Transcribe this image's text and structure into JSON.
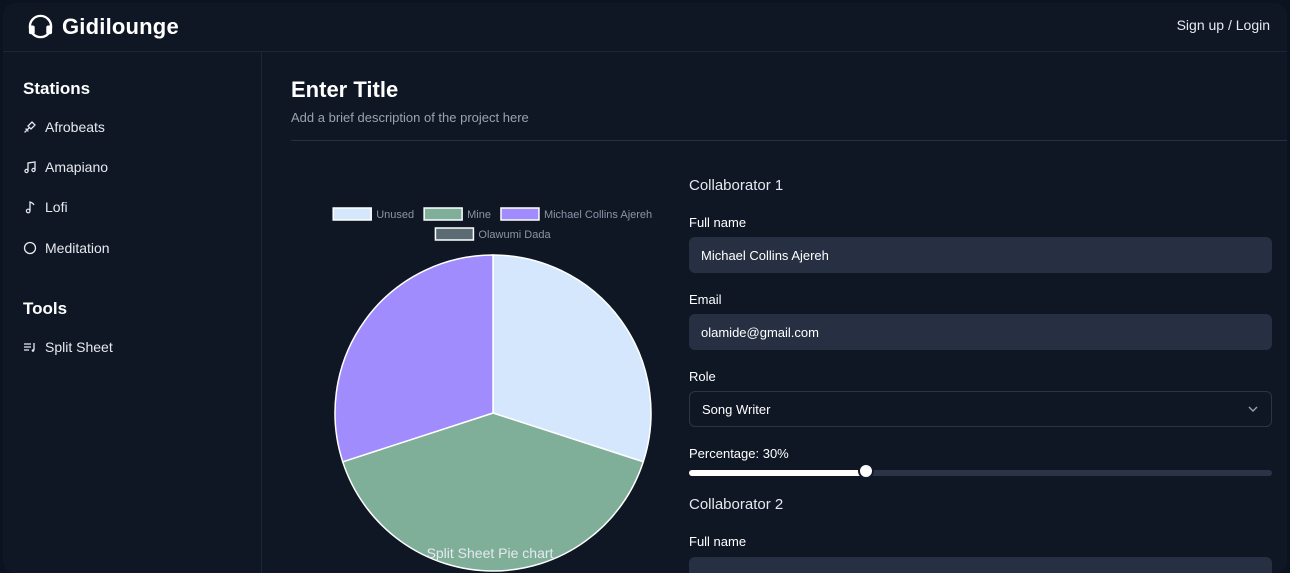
{
  "app": {
    "name": "Gidilounge",
    "auth_link": "Sign up / Login"
  },
  "sidebar": {
    "stations_title": "Stations",
    "stations": [
      {
        "label": "Afrobeats",
        "icon": "guitar-icon"
      },
      {
        "label": "Amapiano",
        "icon": "music-notes-icon"
      },
      {
        "label": "Lofi",
        "icon": "music-note-icon"
      },
      {
        "label": "Meditation",
        "icon": "circle-icon"
      }
    ],
    "tools_title": "Tools",
    "tools": [
      {
        "label": "Split Sheet",
        "icon": "playlist-icon"
      }
    ]
  },
  "main": {
    "title": "Enter Title",
    "description": "Add a brief description of the project here"
  },
  "chart_data": {
    "type": "pie",
    "title": "Split Sheet Pie chart",
    "legend_position": "top",
    "series": [
      {
        "name": "Unused",
        "value": 30,
        "color": "#d4e7fc"
      },
      {
        "name": "Mine",
        "value": 40,
        "color": "#7faf99"
      },
      {
        "name": "Michael Collins Ajereh",
        "value": 30,
        "color": "#a08cfc"
      },
      {
        "name": "Olawumi Dada",
        "value": 0,
        "color": "#5a6b74"
      }
    ]
  },
  "form": {
    "collaborators": [
      {
        "title": "Collaborator 1",
        "full_name_label": "Full name",
        "full_name": "Michael Collins Ajereh",
        "email_label": "Email",
        "email": "olamide@gmail.com",
        "role_label": "Role",
        "role": "Song Writer",
        "percentage_label": "Percentage: 30%",
        "percentage": 30
      },
      {
        "title": "Collaborator 2",
        "full_name_label": "Full name"
      }
    ]
  }
}
